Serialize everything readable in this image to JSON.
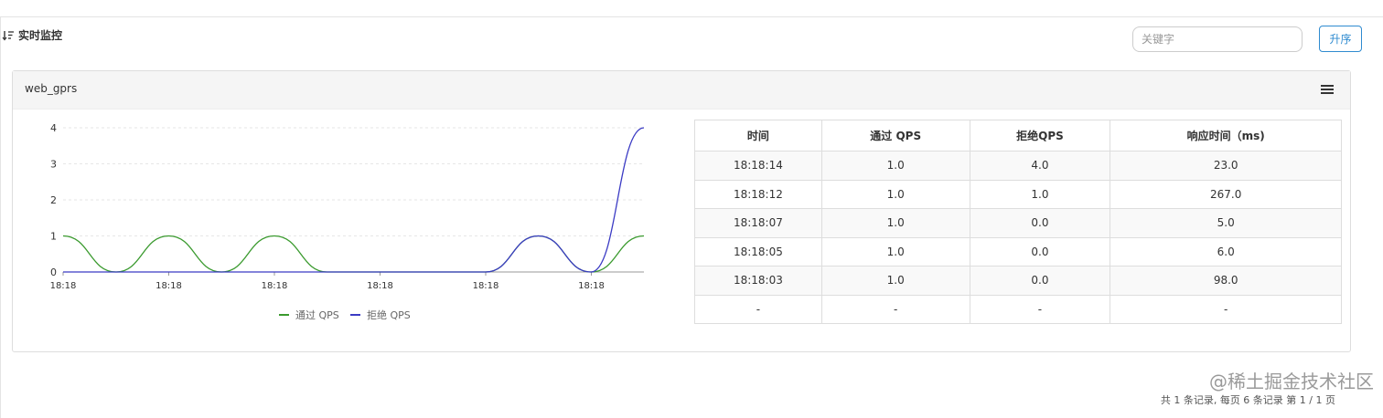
{
  "header": {
    "title": "实时监控",
    "search_placeholder": "关键字",
    "sort_button": "升序"
  },
  "panel": {
    "title": "web_gprs"
  },
  "chart_data": {
    "type": "line",
    "x": [
      "18:18",
      "18:18",
      "18:18",
      "18:18",
      "18:18",
      "18:18"
    ],
    "ylim": [
      0,
      4
    ],
    "yticks": [
      "0",
      "1",
      "2",
      "3",
      "4"
    ],
    "grid": true,
    "legend_position": "bottom",
    "series": [
      {
        "name": "通过 QPS",
        "color": "#3a9a2e",
        "values": [
          1,
          0,
          1,
          0,
          1,
          0,
          0,
          0,
          0,
          1,
          0,
          1
        ]
      },
      {
        "name": "拒绝 QPS",
        "color": "#3b3bc4",
        "values": [
          0,
          0,
          0,
          0,
          0,
          0,
          0,
          0,
          0,
          1,
          0,
          4
        ]
      }
    ]
  },
  "table": {
    "headers": [
      "时间",
      "通过 QPS",
      "拒绝QPS",
      "响应时间（ms)"
    ],
    "rows": [
      [
        "18:18:14",
        "1.0",
        "4.0",
        "23.0"
      ],
      [
        "18:18:12",
        "1.0",
        "1.0",
        "267.0"
      ],
      [
        "18:18:07",
        "1.0",
        "0.0",
        "5.0"
      ],
      [
        "18:18:05",
        "1.0",
        "0.0",
        "6.0"
      ],
      [
        "18:18:03",
        "1.0",
        "0.0",
        "98.0"
      ],
      [
        "-",
        "-",
        "-",
        "-"
      ]
    ]
  },
  "footer": {
    "pagination": "共 1 条记录, 每页 6 条记录 第 1 / 1 页",
    "watermark": "@稀土掘金技术社区"
  }
}
